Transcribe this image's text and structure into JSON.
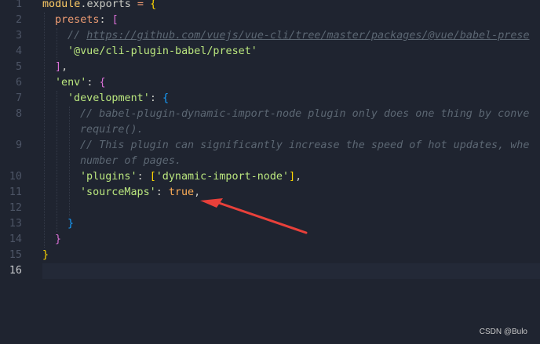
{
  "gutter": {
    "line_numbers": [
      "1",
      "2",
      "3",
      "4",
      "5",
      "6",
      "7",
      "8",
      "",
      "9",
      "",
      "10",
      "11",
      "12",
      "13",
      "14",
      "15",
      "16"
    ]
  },
  "code": {
    "l1_module": "module",
    "l1_dot": ".",
    "l1_exports": "exports",
    "l1_eq": " = ",
    "l1_brace": "{",
    "l2_presets": "presets",
    "l2_colon": ": ",
    "l2_bracket": "[",
    "l3_comment_prefix": "// ",
    "l3_url": "https://github.com/vuejs/vue-cli/tree/master/packages/@vue/babel-prese",
    "l4_str": "'@vue/cli-plugin-babel/preset'",
    "l5_close": "]",
    "l5_comma": ",",
    "l6_env": "'env'",
    "l6_colon": ": ",
    "l6_brace": "{",
    "l7_dev": "'development'",
    "l7_colon": ": ",
    "l7_brace": "{",
    "l8_comment": "// babel-plugin-dynamic-import-node plugin only does one thing by conve",
    "l8b_comment": "require().",
    "l9_comment": "// This plugin can significantly increase the speed of hot updates, whe",
    "l9b_comment": "number of pages.",
    "l10_key": "'plugins'",
    "l10_colon": ": ",
    "l10_open": "[",
    "l10_val": "'dynamic-import-node'",
    "l10_close": "]",
    "l10_comma": ",",
    "l11_key": "'sourceMaps'",
    "l11_colon": ": ",
    "l11_val": "true",
    "l11_comma": ",",
    "l13_close": "}",
    "l14_close": "}",
    "l15_close": "}"
  },
  "watermark": "CSDN @Bulo",
  "colors": {
    "background": "#1f2430",
    "keyword": "#ffcc66",
    "string": "#bae67e",
    "comment": "#5c6773",
    "boolean": "#ffae57",
    "arrow": "#e8403a"
  }
}
